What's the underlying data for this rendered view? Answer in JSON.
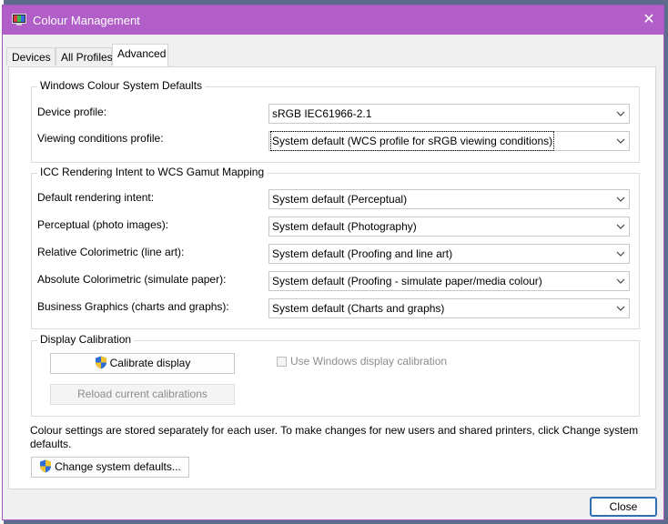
{
  "window": {
    "title": "Colour Management",
    "close_glyph": "✕"
  },
  "tabs": [
    {
      "label": "Devices",
      "active": false
    },
    {
      "label": "All Profiles",
      "active": false
    },
    {
      "label": "Advanced",
      "active": true
    }
  ],
  "wcs_defaults": {
    "title": "Windows Colour System Defaults",
    "device_profile_label": "Device profile:",
    "device_profile_value": "sRGB IEC61966-2.1",
    "viewing_conditions_label": "Viewing conditions profile:",
    "viewing_conditions_value": "System default (WCS profile for sRGB viewing conditions)"
  },
  "icc_mapping": {
    "title": "ICC Rendering Intent to WCS Gamut Mapping",
    "rows": [
      {
        "label": "Default rendering intent:",
        "value": "System default (Perceptual)"
      },
      {
        "label": "Perceptual (photo images):",
        "value": "System default (Photography)"
      },
      {
        "label": "Relative Colorimetric (line art):",
        "value": "System default (Proofing and line art)"
      },
      {
        "label": "Absolute Colorimetric (simulate paper):",
        "value": "System default (Proofing - simulate paper/media colour)"
      },
      {
        "label": "Business Graphics (charts and graphs):",
        "value": "System default (Charts and graphs)"
      }
    ]
  },
  "calibration": {
    "title": "Display Calibration",
    "calibrate_button": "Calibrate display",
    "reload_button": "Reload current calibrations",
    "use_windows_label": "Use Windows display calibration",
    "use_windows_checked": false
  },
  "info_text": "Colour settings are stored separately for each user. To make changes for new users and shared printers, click Change system defaults.",
  "change_defaults_button": "Change system defaults...",
  "close_button": "Close",
  "colors": {
    "titlebar": "#b25ec8",
    "focus_border": "#2f6fb5",
    "shield_blue": "#2b6fd6",
    "shield_yellow": "#f2c230"
  },
  "icons": {
    "title_icon": "monitor-color-icon",
    "shield_icon": "uac-shield-icon",
    "chevron": "chevron-down-icon"
  }
}
